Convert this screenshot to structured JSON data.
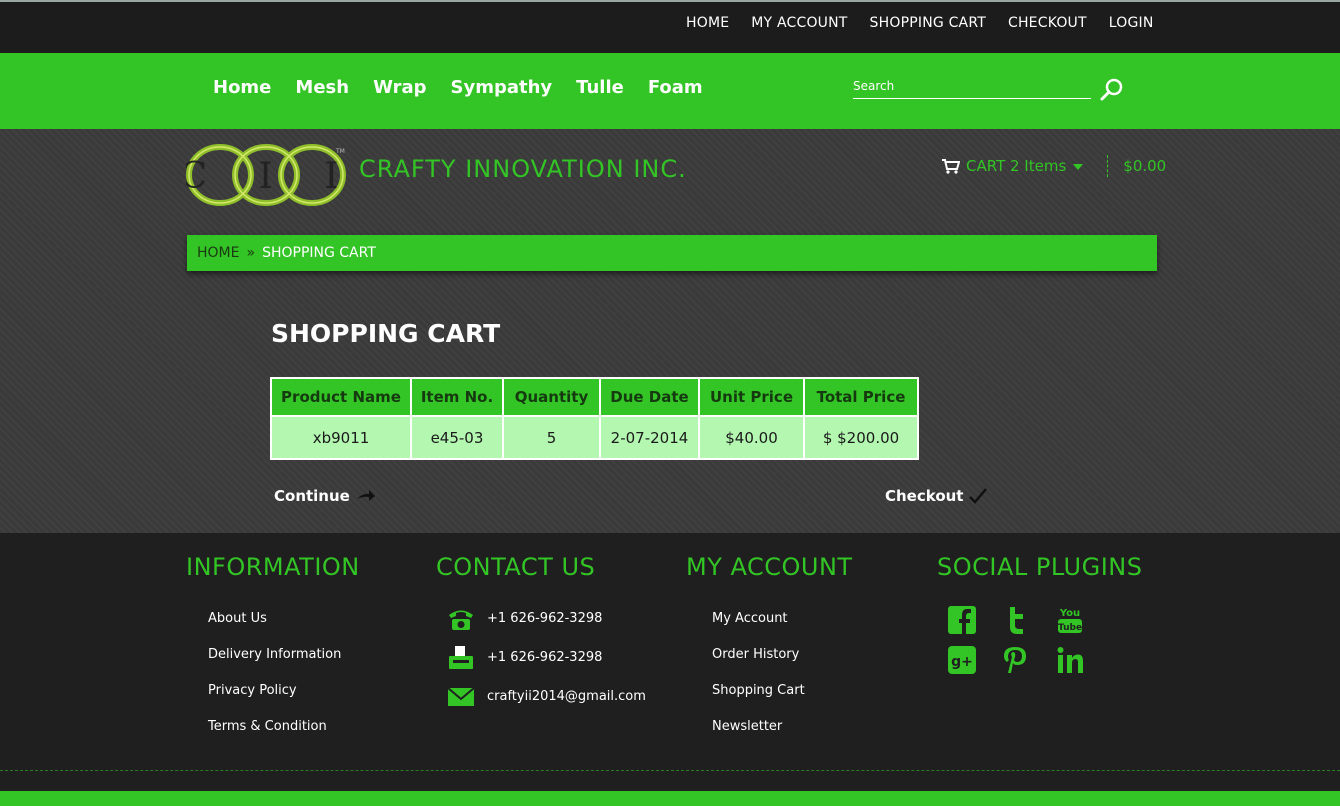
{
  "top_links": [
    "HOME",
    "MY ACCOUNT",
    "SHOPPING CART",
    "CHECKOUT",
    "LOGIN"
  ],
  "menu": [
    "Home",
    "Mesh",
    "Wrap",
    "Sympathy",
    "Tulle",
    "Foam"
  ],
  "search": {
    "placeholder": "Search"
  },
  "logo": {
    "letters": "C I I",
    "tm": "TM"
  },
  "brand": "CRAFTY INNOVATION INC.",
  "cart_summary": {
    "label": "CART 2 Items",
    "total": "$0.00"
  },
  "breadcrumb": {
    "home": "HOME",
    "separator": "»",
    "current": "SHOPPING CART"
  },
  "page_title": "SHOPPING CART",
  "cart_table": {
    "headers": [
      "Product Name",
      "Item No.",
      "Quantity",
      "Due Date",
      "Unit Price",
      "Total Price"
    ],
    "row": [
      "xb9011",
      "e45-03",
      "5",
      "2-07-2014",
      "$40.00",
      "$ $200.00"
    ]
  },
  "continue_label": "Continue",
  "checkout_label": "Checkout",
  "footer": {
    "information": {
      "title": "INFORMATION",
      "links": [
        "About Us",
        "Delivery Information",
        "Privacy Policy",
        "Terms & Condition"
      ]
    },
    "contact": {
      "title": "CONTACT US",
      "phone": "+1 626-962-3298",
      "fax": "+1 626-962-3298",
      "email": "craftyii2014@gmail.com"
    },
    "account": {
      "title": "MY ACCOUNT",
      "links": [
        "My Account",
        "Order History",
        "Shopping Cart",
        "Newsletter"
      ]
    },
    "social": {
      "title": "SOCIAL PLUGINS",
      "icons": [
        "facebook-icon",
        "twitter-icon",
        "youtube-icon",
        "google-plus-icon",
        "pinterest-icon",
        "linkedin-icon"
      ]
    }
  },
  "colors": {
    "accent": "#33c425",
    "cell": "#b3f7b0",
    "dark": "#1f1f1f"
  }
}
